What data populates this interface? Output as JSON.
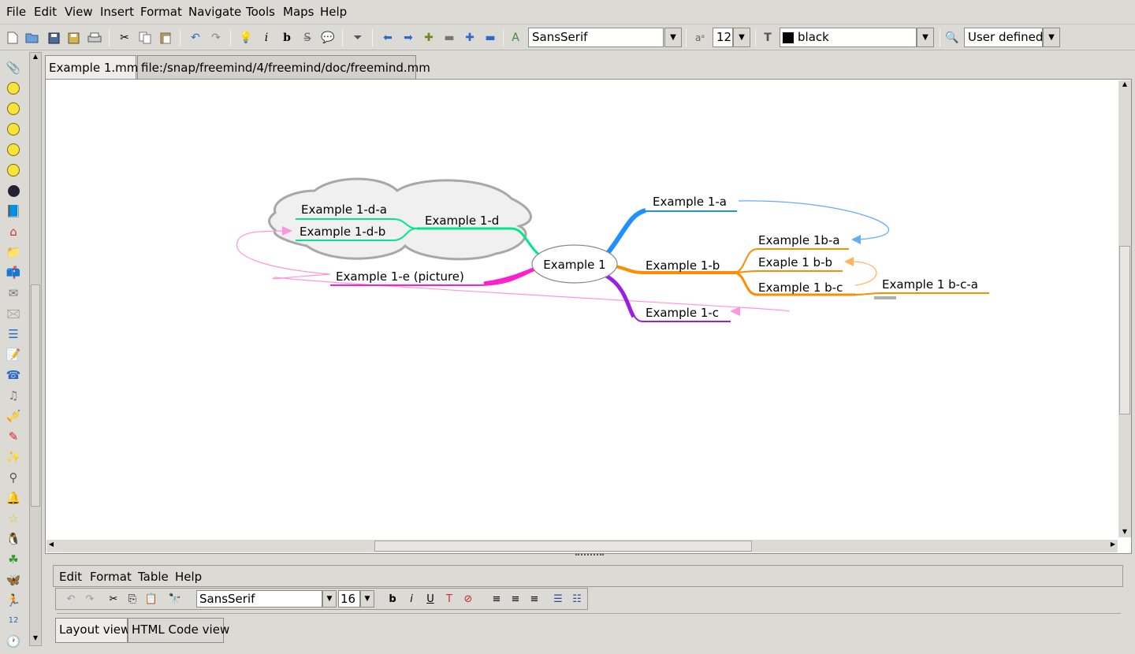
{
  "menubar": {
    "items": [
      "File",
      "Edit",
      "View",
      "Insert",
      "Format",
      "Navigate",
      "Tools",
      "Maps",
      "Help"
    ]
  },
  "toolbar": {
    "font_family": "SansSerif",
    "font_size": "12",
    "color": "black",
    "color_swatch": "#000000",
    "zoom": "User defined."
  },
  "tabs": [
    {
      "label": "Example 1.mm*",
      "active": true
    },
    {
      "label": "file:/snap/freemind/4/freemind/doc/freemind.mm",
      "active": false
    }
  ],
  "mindmap": {
    "root": "Example 1",
    "nodes": {
      "n1a": "Example 1-a",
      "n1ba": "Example 1b-a",
      "n1b": "Example 1-b",
      "n1bb": "Exaple 1 b-b",
      "n1bc": "Example 1 b-c",
      "n1bca": "Example 1 b-c-a",
      "n1c": "Example 1-c",
      "n1d": "Example 1-d",
      "n1da": "Example 1-d-a",
      "n1db": "Example 1-d-b",
      "n1e": "Example 1-e (picture)"
    },
    "colors": {
      "a": "#1e90ff",
      "b": "#ff8c00",
      "c": "#9b1ee6",
      "d": "#00e68c",
      "e": "#ff1ecd",
      "link_blue": "#64aaff",
      "link_orange": "#ffb45a",
      "link_pink": "#ff96dc",
      "cloud_fill": "#f0f0f0",
      "cloud_stroke": "#a8a8a8"
    }
  },
  "note_editor": {
    "menu": [
      "Edit",
      "Format",
      "Table",
      "Help"
    ],
    "font_family": "SansSerif",
    "font_size": "16",
    "view_tabs": [
      "Layout view",
      "HTML Code view"
    ]
  }
}
